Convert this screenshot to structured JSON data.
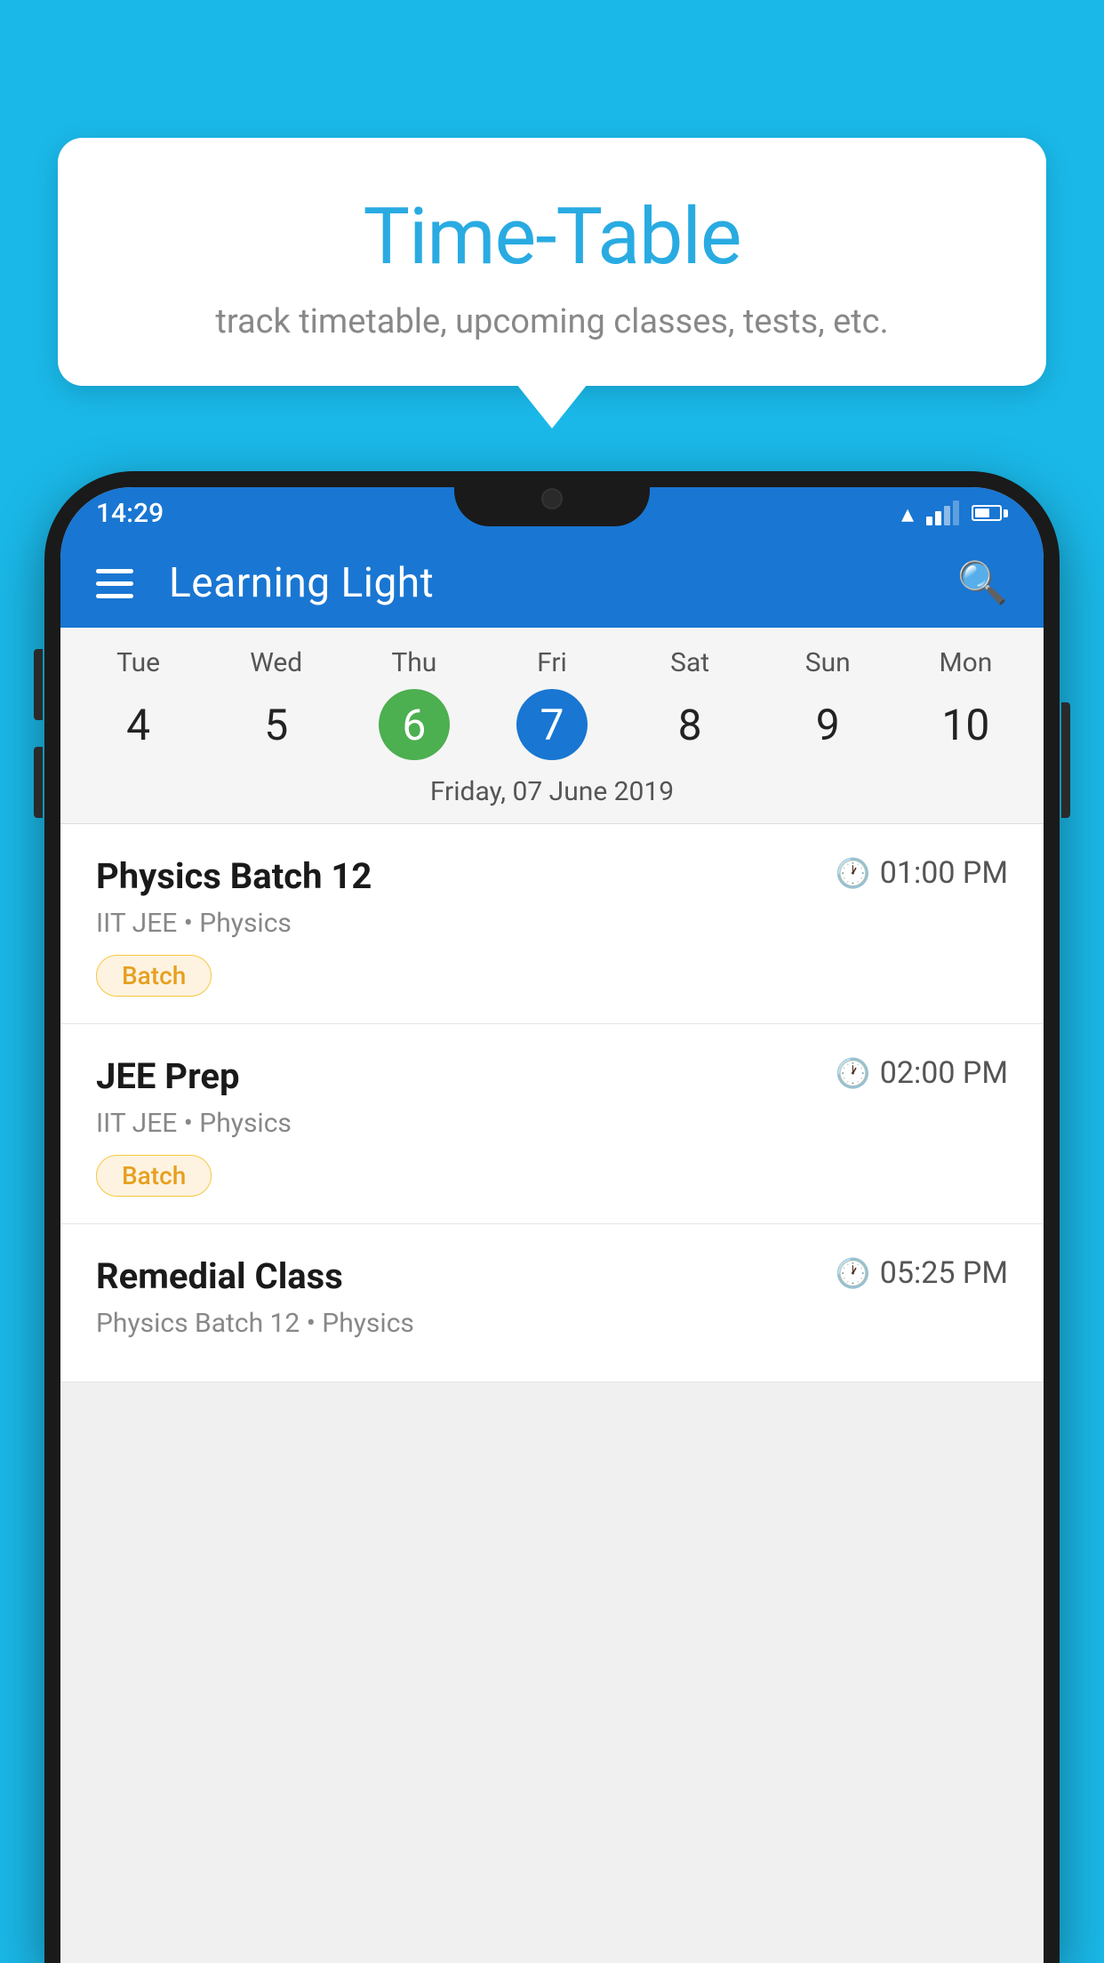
{
  "background_color": "#1ab8e8",
  "hero": {
    "title": "Time-Table",
    "subtitle": "track timetable, upcoming classes, tests, etc."
  },
  "app": {
    "title": "Learning Light",
    "status_time": "14:29"
  },
  "calendar": {
    "selected_date_label": "Friday, 07 June 2019",
    "days": [
      {
        "name": "Tue",
        "num": "4",
        "state": "normal"
      },
      {
        "name": "Wed",
        "num": "5",
        "state": "normal"
      },
      {
        "name": "Thu",
        "num": "6",
        "state": "today"
      },
      {
        "name": "Fri",
        "num": "7",
        "state": "selected"
      },
      {
        "name": "Sat",
        "num": "8",
        "state": "normal"
      },
      {
        "name": "Sun",
        "num": "9",
        "state": "normal"
      },
      {
        "name": "Mon",
        "num": "10",
        "state": "normal"
      }
    ]
  },
  "schedule": [
    {
      "name": "Physics Batch 12",
      "time": "01:00 PM",
      "sub": "IIT JEE • Physics",
      "badge": "Batch"
    },
    {
      "name": "JEE Prep",
      "time": "02:00 PM",
      "sub": "IIT JEE • Physics",
      "badge": "Batch"
    },
    {
      "name": "Remedial Class",
      "time": "05:25 PM",
      "sub": "Physics Batch 12 • Physics",
      "badge": null
    }
  ],
  "buttons": {
    "menu_label": "menu",
    "search_label": "search"
  }
}
